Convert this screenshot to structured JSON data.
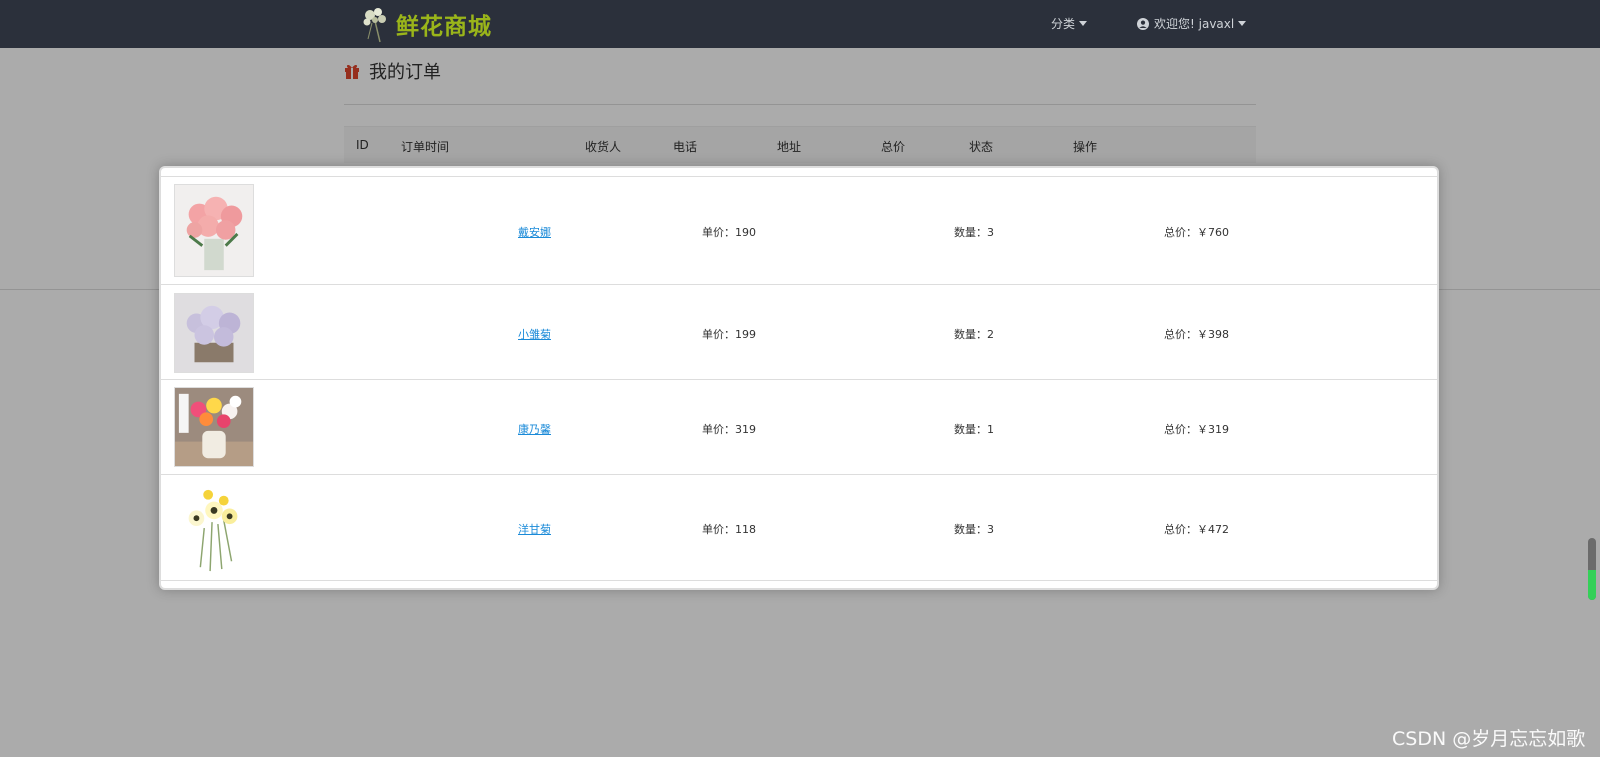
{
  "navbar": {
    "brand": "鲜花商城",
    "category_label": "分类",
    "user_label": "欢迎您! javaxl"
  },
  "page": {
    "title": "我的订单",
    "columns": [
      "ID",
      "订单时间",
      "收货人",
      "电话",
      "地址",
      "总价",
      "状态",
      "操作"
    ]
  },
  "order_items": [
    {
      "name": "戴安娜",
      "unit_price": "单价：190",
      "quantity": "数量：3",
      "total": "总价：￥760",
      "image": "pink-rose-bouquet"
    },
    {
      "name": "小雏菊",
      "unit_price": "单价：199",
      "quantity": "数量：2",
      "total": "总价：￥398",
      "image": "purple-daisy-basket"
    },
    {
      "name": "康乃馨",
      "unit_price": "单价：319",
      "quantity": "数量：1",
      "total": "总价：￥319",
      "image": "carnation-vase"
    },
    {
      "name": "洋甘菊",
      "unit_price": "单价：118",
      "quantity": "数量：3",
      "total": "总价：￥472",
      "image": "chamomile-stems"
    }
  ],
  "watermark": "CSDN @岁月忘忘如歌",
  "colors": {
    "navbar_bg": "#2b303b",
    "brand": "#9ab51a",
    "link": "#1a8ad8",
    "gift_icon": "#e0462d",
    "overlay": "rgba(0,0,0,0.33)"
  }
}
